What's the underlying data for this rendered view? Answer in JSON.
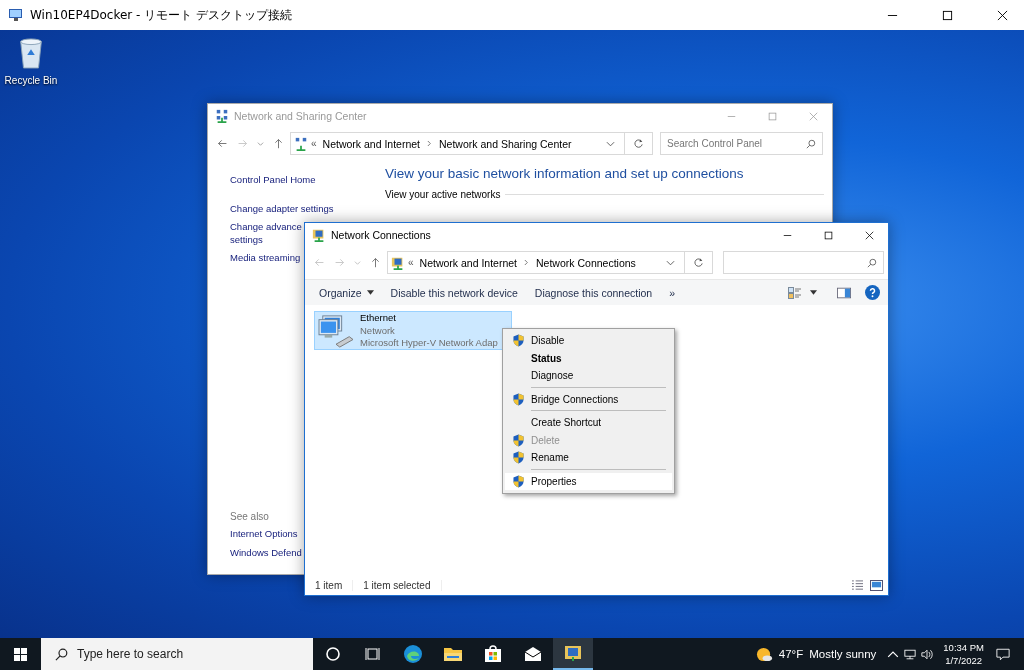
{
  "remote_window": {
    "title": "Win10EP4Docker - リモート デスクトップ接続"
  },
  "desktop_icons": [
    {
      "label": "Recycle Bin"
    }
  ],
  "sharing_center": {
    "title": "Network and Sharing Center",
    "active": false,
    "overflow_mark": "«",
    "breadcrumb": [
      "Network and Internet",
      "Network and Sharing Center"
    ],
    "search": {
      "placeholder": "Search Control Panel"
    },
    "sidebar_links": [
      [
        "Control Panel Home"
      ],
      [
        "Change adapter settings"
      ],
      [
        "Change advance",
        "settings"
      ],
      [
        "Media streaming"
      ]
    ],
    "heading": "View your basic network information and set up connections",
    "section": "View your active networks",
    "see_also": {
      "label": "See also",
      "links": [
        "Internet Options",
        "Windows Defend"
      ]
    }
  },
  "network_connections": {
    "title": "Network Connections",
    "active": true,
    "overflow_mark": "«",
    "breadcrumb": [
      "Network and Internet",
      "Network Connections"
    ],
    "commands": [
      {
        "label": "Organize",
        "dropdown": true
      },
      {
        "label": "Disable this network device",
        "dropdown": false
      },
      {
        "label": "Diagnose this connection",
        "dropdown": false
      },
      {
        "label": "»",
        "dropdown": false
      }
    ],
    "items": [
      {
        "name": "Ethernet",
        "status": "Network",
        "device": "Microsoft Hyper-V Network Adap",
        "selected": true
      }
    ],
    "status_bar": [
      "1 item",
      "1 item selected"
    ]
  },
  "context_menu": [
    {
      "kind": "item",
      "label": "Disable",
      "shield": true,
      "default": false,
      "disabled": false,
      "selected": false
    },
    {
      "kind": "item",
      "label": "Status",
      "shield": false,
      "default": true,
      "disabled": false,
      "selected": false
    },
    {
      "kind": "item",
      "label": "Diagnose",
      "shield": false,
      "default": false,
      "disabled": false,
      "selected": false
    },
    {
      "kind": "separator"
    },
    {
      "kind": "item",
      "label": "Bridge Connections",
      "shield": true,
      "default": false,
      "disabled": false,
      "selected": false
    },
    {
      "kind": "separator"
    },
    {
      "kind": "item",
      "label": "Create Shortcut",
      "shield": false,
      "default": false,
      "disabled": false,
      "selected": false
    },
    {
      "kind": "item",
      "label": "Delete",
      "shield": true,
      "default": false,
      "disabled": true,
      "selected": false
    },
    {
      "kind": "item",
      "label": "Rename",
      "shield": true,
      "default": false,
      "disabled": false,
      "selected": false
    },
    {
      "kind": "separator"
    },
    {
      "kind": "item",
      "label": "Properties",
      "shield": true,
      "default": false,
      "disabled": false,
      "selected": true
    }
  ],
  "taskbar": {
    "search": {
      "placeholder": "Type here to search"
    },
    "apps": [
      {
        "kind": "cortana",
        "selected": false
      },
      {
        "kind": "task-view",
        "selected": false
      },
      {
        "kind": "edge",
        "selected": false
      },
      {
        "kind": "explorer",
        "selected": false
      },
      {
        "kind": "store",
        "selected": false
      },
      {
        "kind": "mail",
        "selected": false
      },
      {
        "kind": "network",
        "selected": true
      }
    ],
    "weather": {
      "temp": "47°F",
      "text": "Mostly sunny"
    },
    "clock": {
      "time": "10:34 PM",
      "date": "1/7/2022"
    }
  }
}
